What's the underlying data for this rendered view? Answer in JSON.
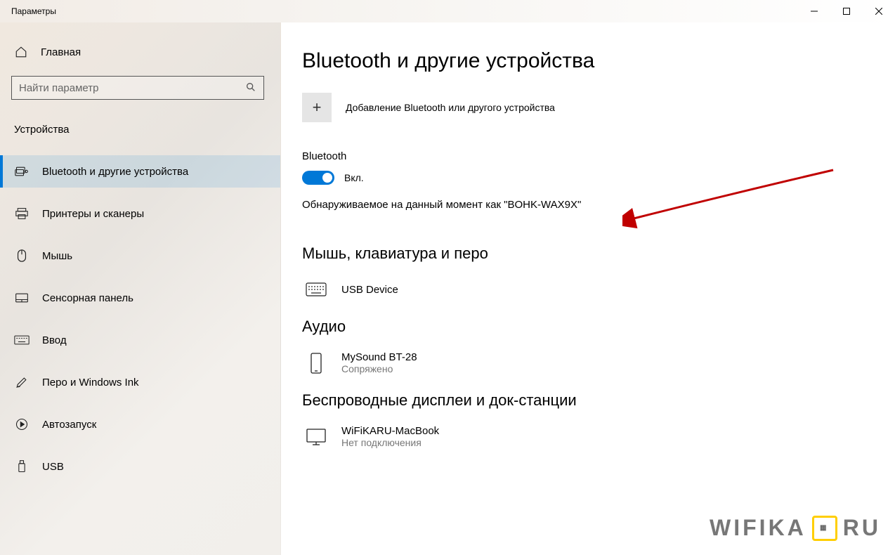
{
  "window": {
    "title": "Параметры"
  },
  "sidebar": {
    "home": "Главная",
    "search_placeholder": "Найти параметр",
    "section": "Устройства",
    "items": [
      {
        "label": "Bluetooth и другие устройства"
      },
      {
        "label": "Принтеры и сканеры"
      },
      {
        "label": "Мышь"
      },
      {
        "label": "Сенсорная панель"
      },
      {
        "label": "Ввод"
      },
      {
        "label": "Перо и Windows Ink"
      },
      {
        "label": "Автозапуск"
      },
      {
        "label": "USB"
      }
    ]
  },
  "main": {
    "heading": "Bluetooth и другие устройства",
    "add_device": "Добавление Bluetooth или другого устройства",
    "bluetooth_label": "Bluetooth",
    "toggle_state": "Вкл.",
    "discoverable": "Обнаруживаемое на данный момент как \"BOHK-WAX9X\"",
    "sections": {
      "input_devices": {
        "title": "Мышь, клавиатура и перо",
        "items": [
          {
            "name": "USB Device",
            "status": ""
          }
        ]
      },
      "audio": {
        "title": "Аудио",
        "items": [
          {
            "name": "MySound BT-28",
            "status": "Сопряжено"
          }
        ]
      },
      "wireless_displays": {
        "title": "Беспроводные дисплеи и док-станции",
        "items": [
          {
            "name": "WiFiKARU-MacBook",
            "status": "Нет подключения"
          }
        ]
      }
    }
  },
  "watermark": {
    "left": "WIFIKA",
    "right": "RU"
  }
}
